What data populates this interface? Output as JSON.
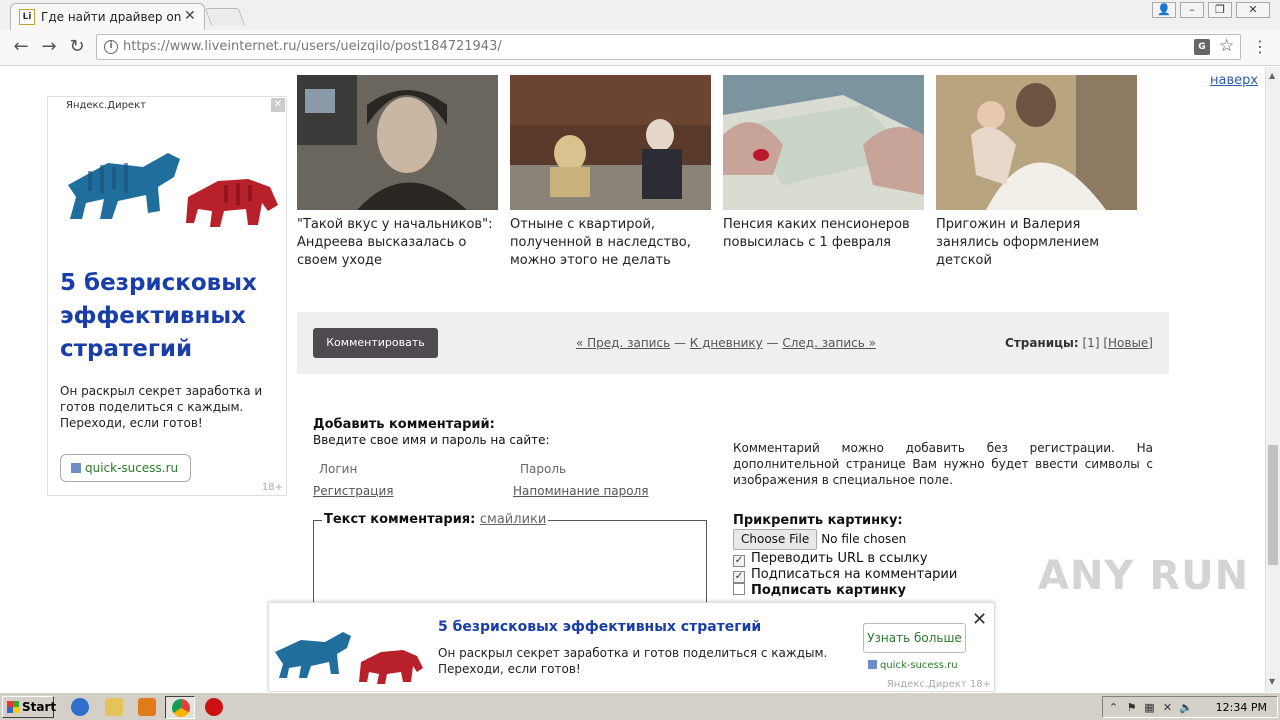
{
  "browser": {
    "tab_title": "Где найти драйвер onext",
    "tab_favicon": "Li",
    "url_prefix": "https://www.liveinternet.ru",
    "url_path": "/users/ueizqilo/post184721943/",
    "icons": {
      "back": "arrow-left-icon",
      "forward": "arrow-right-icon",
      "reload": "reload-icon",
      "info": "info-icon",
      "translate": "translate-icon",
      "bookmark": "star-icon",
      "menu": "menu-dots-icon"
    }
  },
  "page": {
    "to_top_link": "наверх",
    "left_ad": {
      "label": "Яндекс.Директ",
      "title": "5 безрисковых эффективных стратегий",
      "text": "Он раскрыл секрет заработка и готов поделиться с каждым. Переходи, если готов!",
      "domain": "quick-sucess.ru",
      "age": "18+"
    },
    "related": [
      {
        "caption": "\"Такой вкус у начальников\": Андреева высказалась о своем уходе",
        "thumb_colors": [
          "#6a665d",
          "#c9b7a4",
          "#2a2622"
        ]
      },
      {
        "caption": "Отныне с квартирой, полученной в наследство, можно этого не делать",
        "thumb_colors": [
          "#5a3a2a",
          "#d8c28e",
          "#2c2c34"
        ]
      },
      {
        "caption": "Пенсия каких пенсионеров повысилась с 1 февраля",
        "thumb_colors": [
          "#c7a398",
          "#d9ddd1",
          "#7b94a0"
        ]
      },
      {
        "caption": "Пригожин и Валерия занялись оформлением детской",
        "thumb_colors": [
          "#b8a47f",
          "#f2eee8",
          "#6b5442"
        ]
      }
    ],
    "navbar": {
      "comment_button": "Комментировать",
      "prev": "« Пред. запись",
      "sep1": " — ",
      "diary": "К дневнику",
      "sep2": " — ",
      "next": "След. запись »",
      "pages_label": "Страницы:",
      "pages_current": " [1] ",
      "pages_new": "[Новые]"
    },
    "comment_form": {
      "heading": "Добавить комментарий:",
      "subheading": "Введите свое имя и пароль на сайте:",
      "login_label": "Логин",
      "password_label": "Пароль",
      "register_link": "Регистрация",
      "remind_link": "Напоминание пароля",
      "text_legend": "Текст комментария:",
      "smilies_link": "смайлики",
      "reg_note": "Комментарий можно добавить без регистрации. На дополнительной странице Вам нужно будет ввести символы с изображения в специальное поле.",
      "attach_heading": "Прикрепить картинку:",
      "choose_file": "Choose File",
      "no_file": "No file chosen",
      "checkboxes": [
        {
          "label": "Переводить URL в ссылку",
          "checked": true,
          "bold": false
        },
        {
          "label": "Подписаться на комментарии",
          "checked": true,
          "bold": false
        },
        {
          "label": "Подписать картинку",
          "checked": false,
          "bold": true
        }
      ]
    },
    "bottom_ad": {
      "title": "5 безрисковых эффективных стратегий",
      "text": "Он раскрыл секрет заработка и готов поделиться с каждым. Переходи, если готов!",
      "button": "Узнать больше",
      "domain": "quick-sucess.ru",
      "footer": "Яндекс.Директ 18+"
    }
  },
  "watermark": "ANY RUN",
  "taskbar": {
    "start": "Start",
    "clock": "12:34 PM"
  },
  "colors": {
    "ad_title": "#1a3ea8",
    "link": "#2a5db0",
    "ad_domain": "#2a7a2a",
    "comment_button": "#4e4a4f",
    "navstrip": "#efefef"
  }
}
